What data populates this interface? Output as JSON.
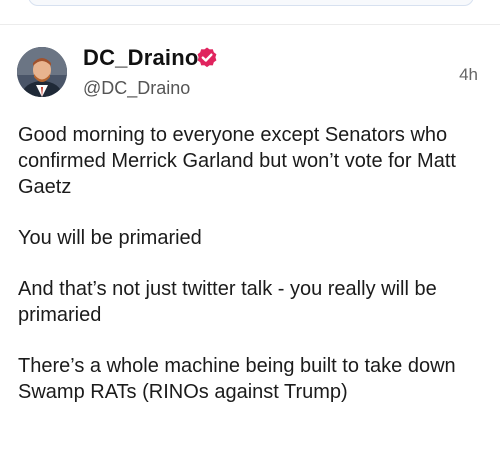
{
  "post": {
    "display_name": "DC_Draino",
    "handle": "@DC_Draino",
    "timestamp": "4h",
    "verified": true,
    "badge_color": "#e0245e",
    "paragraphs": [
      "Good morning to everyone except Senators who confirmed Merrick Garland but won’t vote for Matt Gaetz",
      "You will be primaried",
      "And that’s not just twitter talk - you really will be primaried",
      "There’s a whole machine being built to take down Swamp RATs (RINOs against Trump)"
    ]
  }
}
